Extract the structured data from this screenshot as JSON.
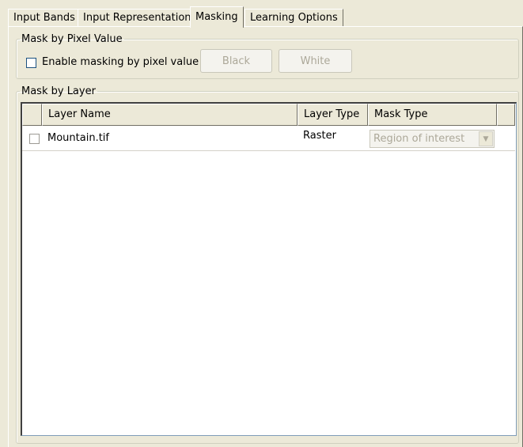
{
  "tabs": [
    {
      "label": "Input Bands"
    },
    {
      "label": "Input Representation"
    },
    {
      "label": "Masking"
    },
    {
      "label": "Learning Options"
    }
  ],
  "active_tab": "Masking",
  "mask_by_pixel": {
    "title": "Mask by Pixel Value",
    "enable_label": "Enable masking by pixel value",
    "enable_checked": false,
    "black_label": "Black",
    "white_label": "White"
  },
  "mask_by_layer": {
    "title": "Mask by Layer",
    "columns": {
      "layer_name": "Layer Name",
      "layer_type": "Layer Type",
      "mask_type": "Mask Type"
    },
    "rows": [
      {
        "checked": false,
        "layer_name": "Mountain.tif",
        "layer_type": "Raster",
        "mask_type": "Region of interest"
      }
    ]
  },
  "colors": {
    "background": "#ece9d8",
    "disabled_text": "#aca899",
    "checkbox_border": "#1c5180"
  }
}
